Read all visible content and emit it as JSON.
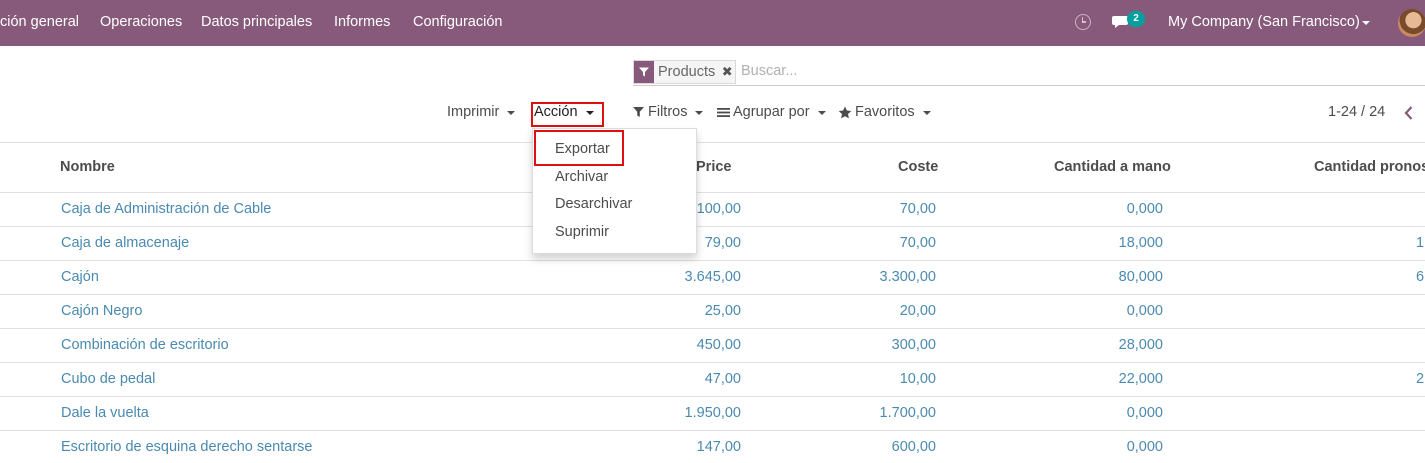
{
  "navbar": {
    "menu": [
      "ción general",
      "Operaciones",
      "Datos principales",
      "Informes",
      "Configuración"
    ],
    "chat_badge": "2",
    "company": "My Company (San Francisco)"
  },
  "search": {
    "facet_label": "Products",
    "placeholder": "Buscar..."
  },
  "toolbar": {
    "print_label": "Imprimir",
    "action_label": "Acción",
    "filters_label": "Filtros",
    "group_label": "Agrupar por",
    "favorites_label": "Favoritos",
    "pager": "1-24 / 24"
  },
  "action_menu": [
    "Exportar",
    "Archivar",
    "Desarchivar",
    "Suprimir"
  ],
  "table": {
    "columns": [
      "Nombre",
      "Price",
      "Coste",
      "Cantidad a mano",
      "Cantidad pronost"
    ],
    "rows": [
      {
        "name": "Caja de Administración de Cable",
        "price": "100,00",
        "cost": "70,00",
        "qty": "0,000",
        "forecast": ""
      },
      {
        "name": "Caja de almacenaje",
        "price": "79,00",
        "cost": "70,00",
        "qty": "18,000",
        "forecast": "1"
      },
      {
        "name": "Cajón",
        "price": "3.645,00",
        "cost": "3.300,00",
        "qty": "80,000",
        "forecast": "6"
      },
      {
        "name": "Cajón Negro",
        "price": "25,00",
        "cost": "20,00",
        "qty": "0,000",
        "forecast": ""
      },
      {
        "name": "Combinación de escritorio",
        "price": "450,00",
        "cost": "300,00",
        "qty": "28,000",
        "forecast": ""
      },
      {
        "name": "Cubo de pedal",
        "price": "47,00",
        "cost": "10,00",
        "qty": "22,000",
        "forecast": "2"
      },
      {
        "name": "Dale la vuelta",
        "price": "1.950,00",
        "cost": "1.700,00",
        "qty": "0,000",
        "forecast": ""
      },
      {
        "name": "Escritorio de esquina derecho sentarse",
        "price": "147,00",
        "cost": "600,00",
        "qty": "0,000",
        "forecast": ""
      }
    ]
  },
  "colors": {
    "navbar": "#875a7b",
    "link": "#4a8ab0",
    "badge": "#00a09d",
    "highlight": "#dd1111"
  }
}
